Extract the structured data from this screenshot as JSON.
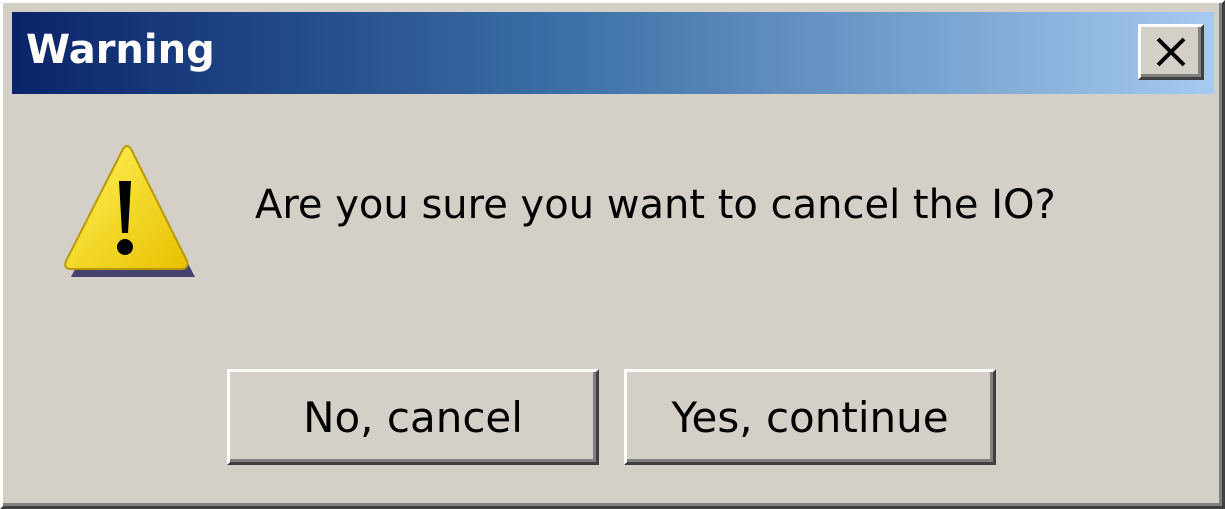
{
  "dialog": {
    "title": "Warning",
    "message": "Are you sure you want to cancel the IO?",
    "icon": "warning-icon",
    "close_icon": "close-icon"
  },
  "buttons": {
    "cancel_label": "No, cancel",
    "continue_label": "Yes, continue"
  },
  "colors": {
    "titlebar_start": "#0a246a",
    "titlebar_end": "#a6caf0",
    "dialog_background": "#d4d0c8",
    "warning_yellow": "#f5d800"
  }
}
